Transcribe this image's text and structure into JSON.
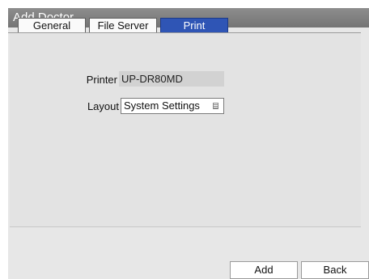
{
  "window": {
    "title": "Add Doctor"
  },
  "tabs": [
    {
      "label": "General",
      "active": false
    },
    {
      "label": "File Server",
      "active": false
    },
    {
      "label": "Print",
      "active": true
    }
  ],
  "print": {
    "printer_label": "Printer",
    "printer_value": "UP-DR80MD",
    "layout_label": "Layout",
    "layout_value": "System Settings"
  },
  "buttons": {
    "add": "Add",
    "back": "Back"
  },
  "colors": {
    "active_tab": "#2f55b5",
    "titlebar": "#808080",
    "panel": "#e3e3e3"
  }
}
